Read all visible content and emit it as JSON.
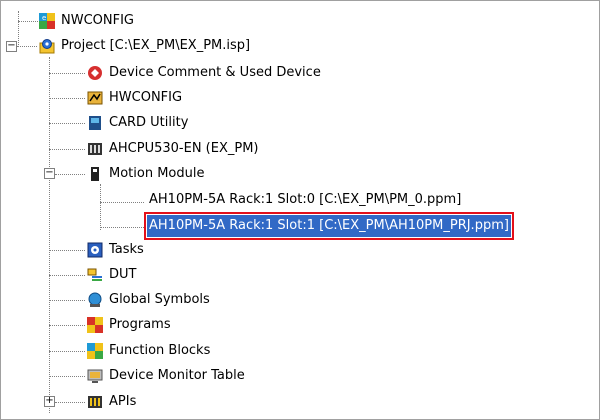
{
  "tree": {
    "root": {
      "label": "NWCONFIG",
      "icon": "nwconfig-icon"
    },
    "project": {
      "label": "Project [C:\\EX_PM\\EX_PM.isp]",
      "icon": "project-gear-icon",
      "expander": "−"
    },
    "items": [
      {
        "label": "Device Comment & Used Device",
        "icon": "device-comment-icon"
      },
      {
        "label": "HWCONFIG",
        "icon": "hwconfig-icon"
      },
      {
        "label": "CARD Utility",
        "icon": "card-utility-icon"
      },
      {
        "label": "AHCPU530-EN  (EX_PM)",
        "icon": "cpu-icon"
      },
      {
        "label": "Motion Module",
        "icon": "motion-module-icon",
        "expander": "−"
      },
      {
        "label": "Tasks",
        "icon": "tasks-icon"
      },
      {
        "label": "DUT",
        "icon": "dut-icon"
      },
      {
        "label": "Global Symbols",
        "icon": "global-symbols-icon"
      },
      {
        "label": "Programs",
        "icon": "programs-icon"
      },
      {
        "label": "Function Blocks",
        "icon": "function-blocks-icon"
      },
      {
        "label": "Device Monitor Table",
        "icon": "device-monitor-icon"
      },
      {
        "label": "APIs",
        "icon": "apis-icon",
        "expander": "+"
      }
    ],
    "motion_children": [
      {
        "label": "AH10PM-5A Rack:1 Slot:0 [C:\\EX_PM\\PM_0.ppm]",
        "selected": false
      },
      {
        "label": "AH10PM-5A Rack:1 Slot:1 [C:\\EX_PM\\AH10PM_PRJ.ppm]",
        "selected": true
      }
    ]
  },
  "colors": {
    "selection": "#3169c6",
    "highlight_border": "#e3101a"
  }
}
